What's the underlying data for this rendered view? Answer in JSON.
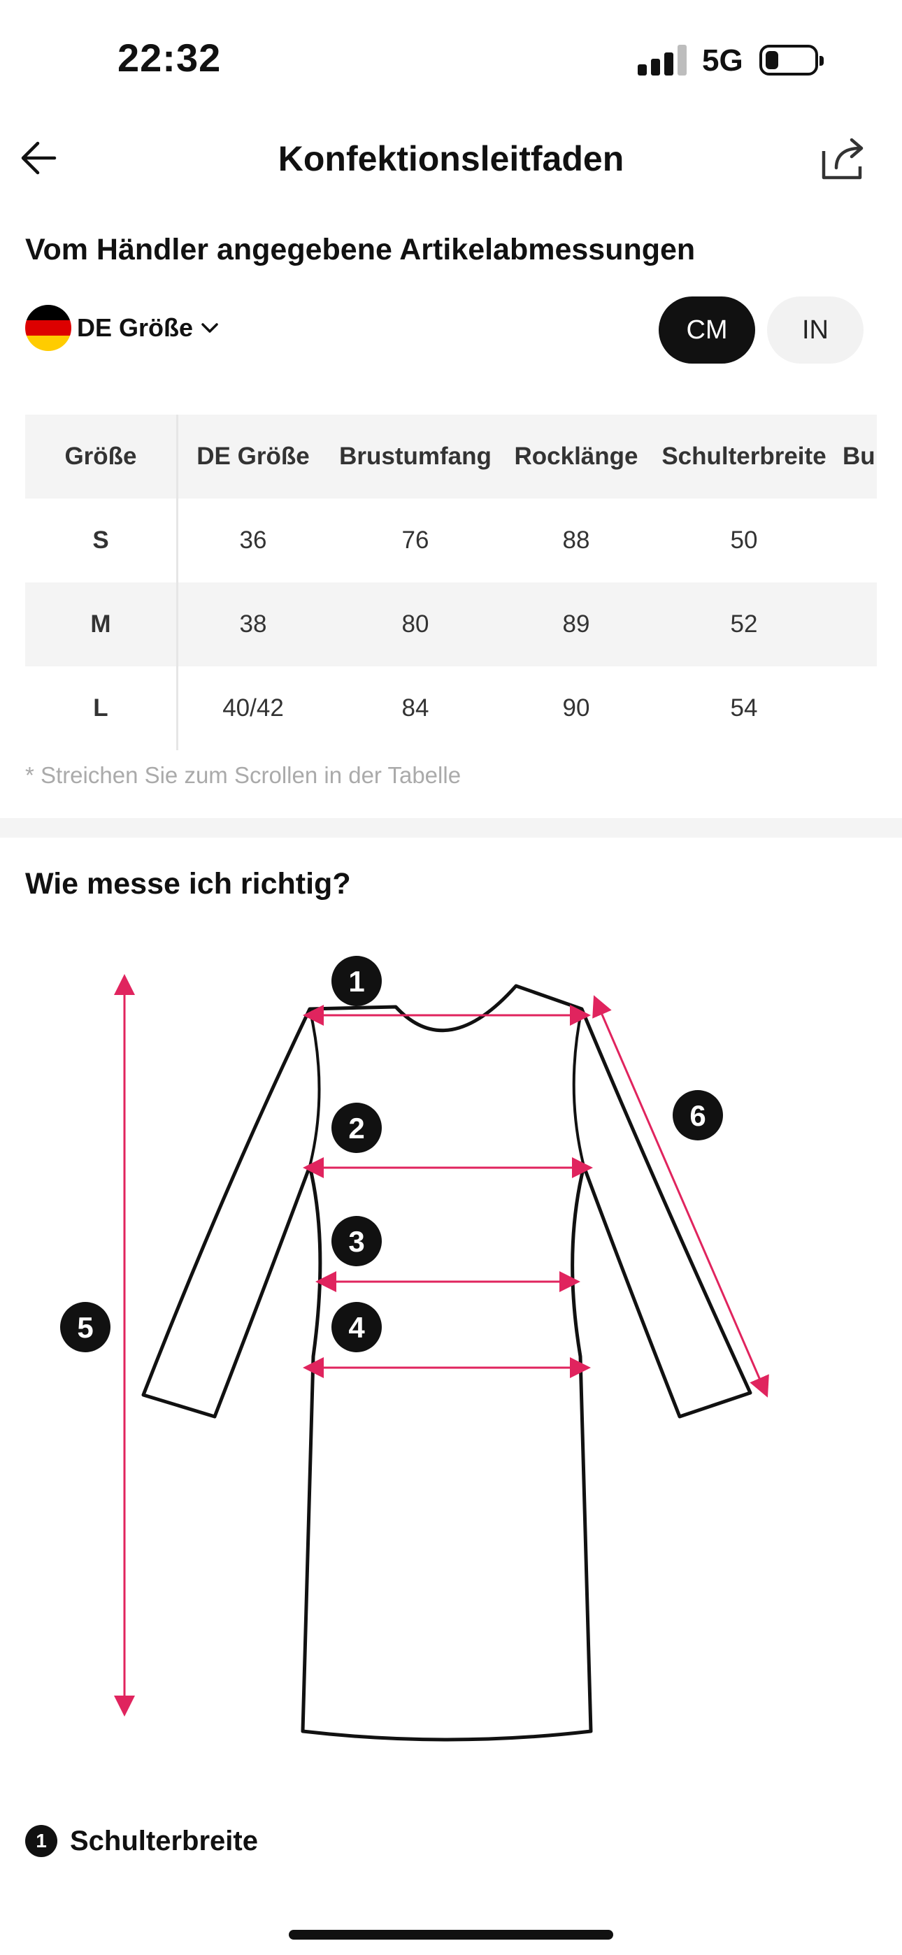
{
  "status_bar": {
    "time": "22:32",
    "network": "5G"
  },
  "nav": {
    "title": "Konfektionsleitfaden"
  },
  "merchant_section": {
    "heading": "Vom Händler angegebene Artikelabmessungen",
    "size_system": "DE Größe",
    "units": {
      "cm": "CM",
      "in": "IN",
      "selected": "CM"
    }
  },
  "size_table": {
    "headers": [
      "Größe",
      "DE Größe",
      "Brustumfang",
      "Rocklänge",
      "Schulterbreite",
      "Bu"
    ],
    "rows": [
      [
        "S",
        "36",
        "76",
        "88",
        "50"
      ],
      [
        "M",
        "38",
        "80",
        "89",
        "52"
      ],
      [
        "L",
        "40/42",
        "84",
        "90",
        "54"
      ]
    ],
    "hint": "* Streichen Sie zum Scrollen in der Tabelle"
  },
  "measure_section": {
    "heading": "Wie messe ich richtig?",
    "markers": [
      "1",
      "2",
      "3",
      "4",
      "5",
      "6"
    ]
  },
  "first_item": {
    "number": "1",
    "title": "Schulterbreite"
  },
  "colors": {
    "accent": "#e0245e",
    "dark": "#111111",
    "table_shade": "#f4f4f4"
  }
}
